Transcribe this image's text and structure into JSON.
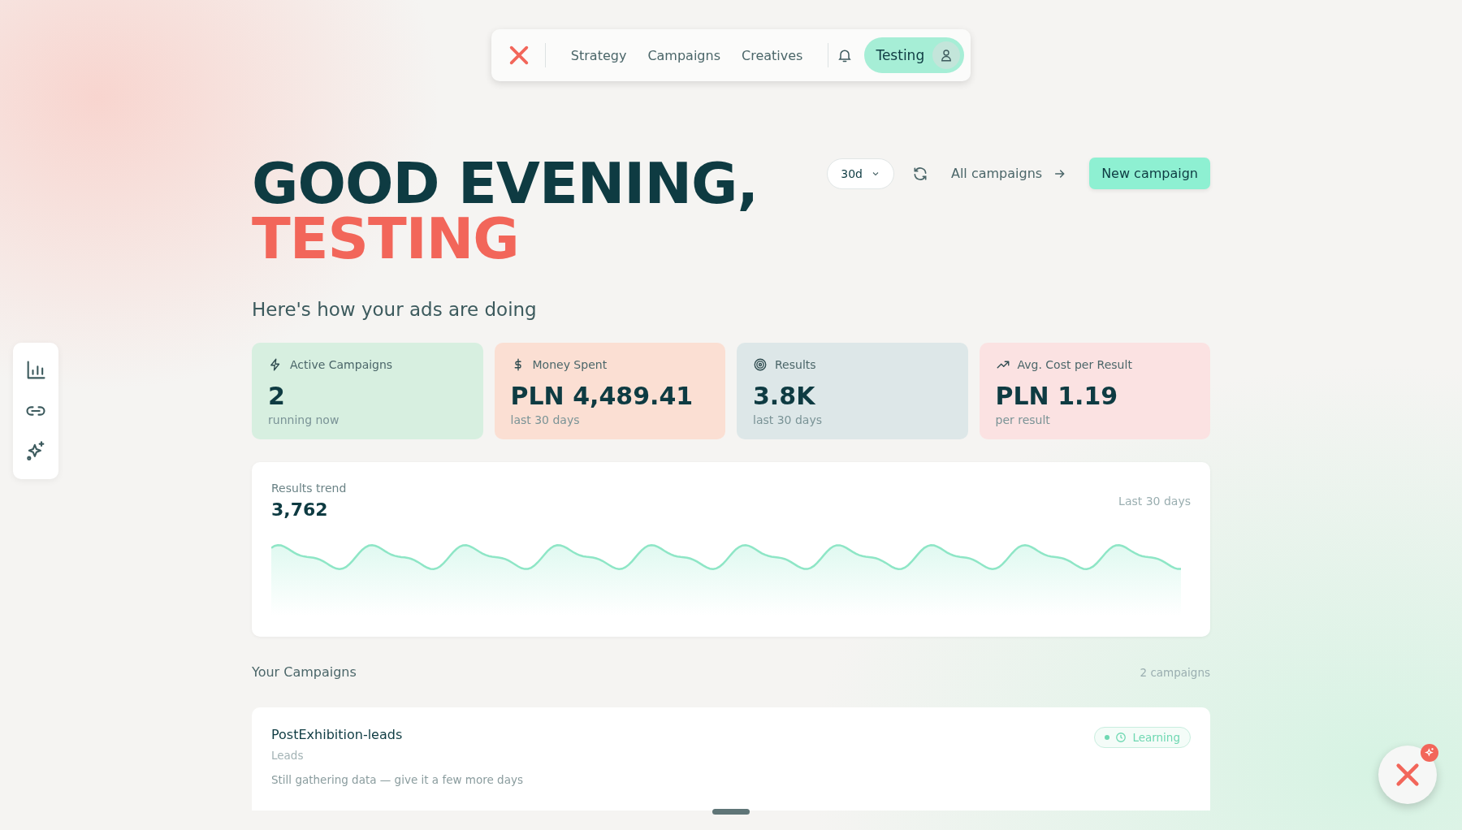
{
  "nav": {
    "links": [
      {
        "label": "Strategy",
        "selected": false
      },
      {
        "label": "Campaigns",
        "selected": false
      },
      {
        "label": "Creatives",
        "selected": false
      }
    ],
    "user": "Testing"
  },
  "sidebar": {
    "items": [
      {
        "kind": "chart"
      },
      {
        "kind": "link"
      },
      {
        "kind": "sparkle"
      }
    ]
  },
  "header": {
    "greeting": "GOOD EVENING,",
    "name": "TESTING",
    "subtitle": "Here's how your ads are doing",
    "period": "30d",
    "all_link": "All campaigns",
    "new_button": "New campaign"
  },
  "stats": [
    {
      "kind": "bolt",
      "label": "Active Campaigns",
      "value": "2",
      "note": "running now",
      "color": "#d7efe0"
    },
    {
      "kind": "dollar",
      "label": "Money Spent",
      "value": "PLN 4,489.41",
      "note": "last 30 days",
      "color": "#fbdfd3"
    },
    {
      "kind": "target",
      "label": "Results",
      "value": "3.8K",
      "note": "last 30 days",
      "color": "#dde7e8"
    },
    {
      "kind": "trend",
      "label": "Avg. Cost per Result",
      "value": "PLN 1.19",
      "note": "per result",
      "color": "#fbe2e2"
    }
  ],
  "trend": {
    "title": "Results trend",
    "value": "3,762",
    "range": "Last 30 days"
  },
  "campaigns": {
    "title": "Your Campaigns",
    "count": "2 campaigns",
    "items": [
      {
        "name": "PostExhibition-leads",
        "objective": "Leads",
        "status": "Learning",
        "note": "Still gathering data — give it a few more days"
      }
    ]
  }
}
